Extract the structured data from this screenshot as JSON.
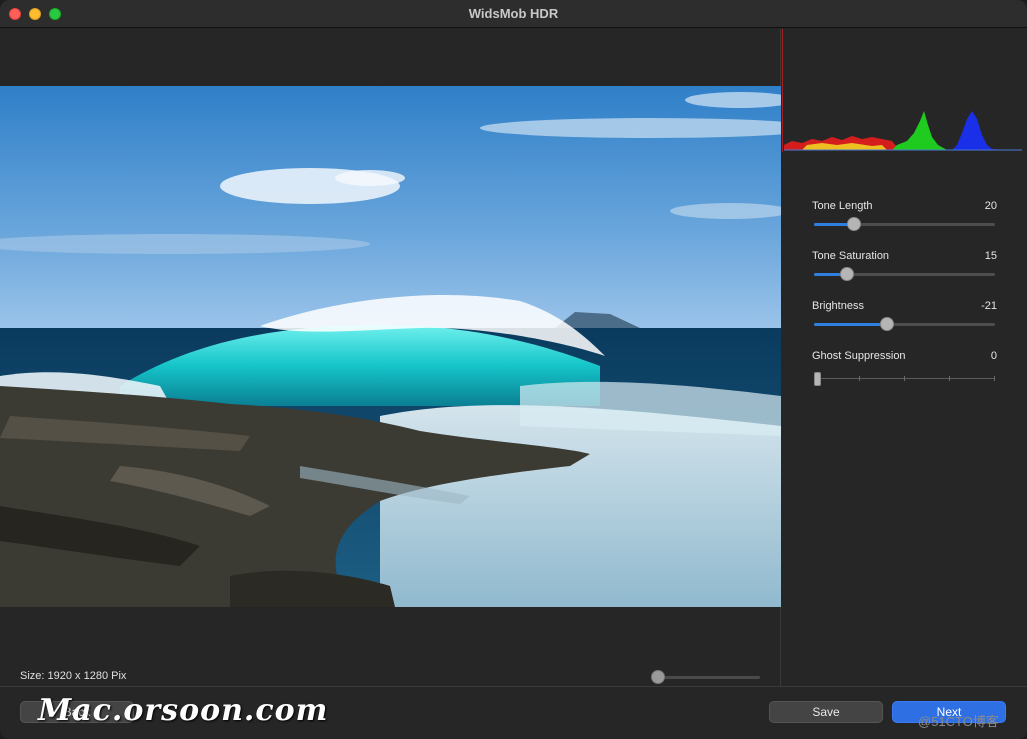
{
  "window": {
    "title": "WidsMob HDR"
  },
  "image": {
    "size_label": "Size: 1920 x 1280 Pix",
    "zoom": 0
  },
  "histogram": {
    "channels": [
      "red",
      "green",
      "blue"
    ]
  },
  "sliders": [
    {
      "label": "Tone Length",
      "value": "20",
      "fraction": 0.22
    },
    {
      "label": "Tone Saturation",
      "value": "15",
      "fraction": 0.18
    },
    {
      "label": "Brightness",
      "value": "-21",
      "fraction": 0.4
    },
    {
      "label": "Ghost Suppression",
      "value": "0",
      "fraction": 0.0
    }
  ],
  "buttons": {
    "back": "Back",
    "save": "Save",
    "next": "Next"
  },
  "watermarks": {
    "main": "Mac.orsoon.com",
    "corner": "@51CTO博客"
  },
  "colors": {
    "accent": "#2f6fe4",
    "slider_fill": "#2f7fe0"
  }
}
